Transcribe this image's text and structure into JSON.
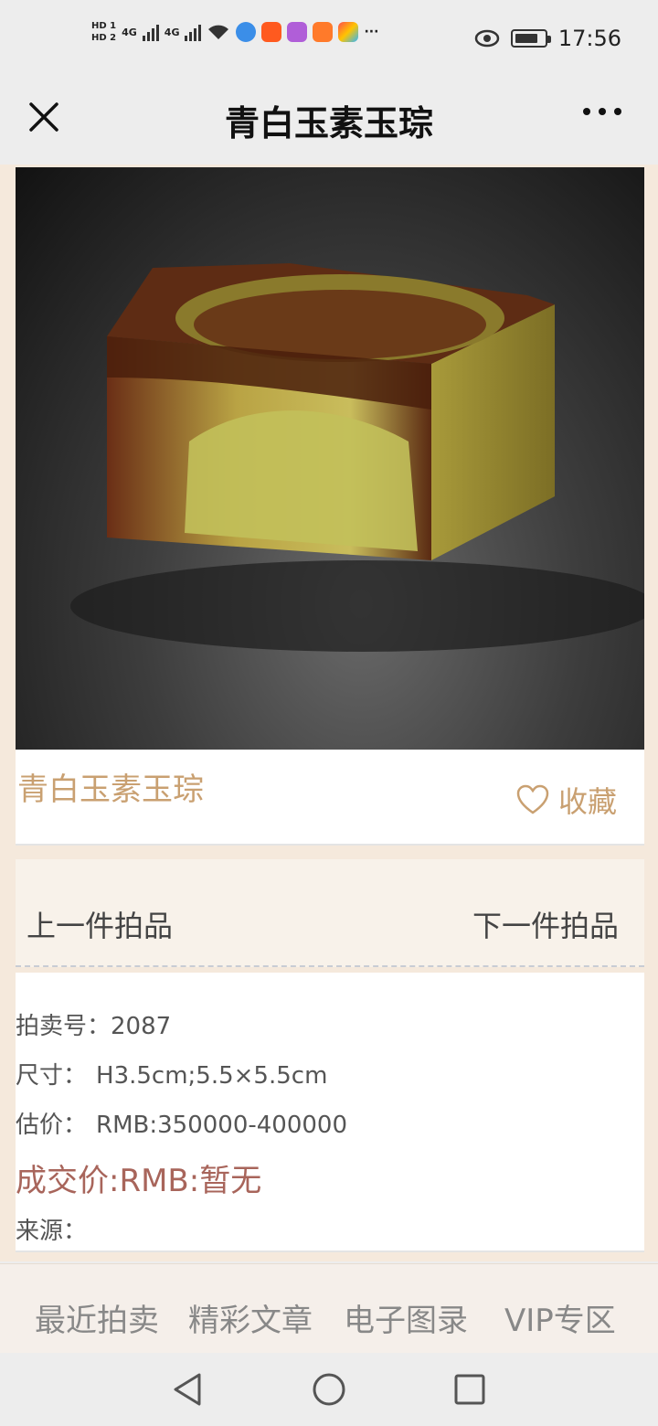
{
  "status_bar": {
    "hd1": "HD 1",
    "hd2": "HD 2",
    "net1": "4G",
    "net2": "4G",
    "app_more": "···",
    "time": "17:56",
    "battery_level": 0.8
  },
  "header": {
    "title": "青白玉素玉琮"
  },
  "product": {
    "name": "青白玉素玉琮",
    "favorite_label": "收藏"
  },
  "navigation": {
    "prev": "上一件拍品",
    "next": "下一件拍品"
  },
  "details": {
    "lot_label": "拍卖号：",
    "lot_value": "2087",
    "size_label": "尺寸：",
    "size_value": "H3.5cm;5.5×5.5cm",
    "estimate_label": "估价：",
    "estimate_value": "RMB:350000-400000",
    "deal_price": "成交价:RMB:暂无",
    "source_label": "来源："
  },
  "bottom_nav": [
    {
      "label": "最近拍卖"
    },
    {
      "label": "精彩文章"
    },
    {
      "label": "电子图录"
    },
    {
      "label": "VIP专区"
    }
  ],
  "colors": {
    "accent_gold": "#c9a071",
    "price_red": "#a8655b",
    "page_bg": "#f5e9dc"
  }
}
